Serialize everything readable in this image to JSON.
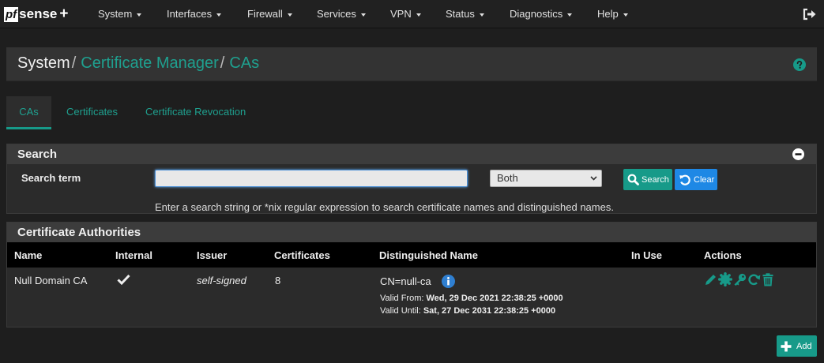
{
  "brand": {
    "logo_pf": "pf",
    "logo_sense": "sense",
    "logo_plus": "+"
  },
  "nav": {
    "items": [
      {
        "label": "System"
      },
      {
        "label": "Interfaces"
      },
      {
        "label": "Firewall"
      },
      {
        "label": "Services"
      },
      {
        "label": "VPN"
      },
      {
        "label": "Status"
      },
      {
        "label": "Diagnostics"
      },
      {
        "label": "Help"
      }
    ]
  },
  "breadcrumb": {
    "root": "System",
    "sep": "/",
    "section": "Certificate Manager",
    "page": "CAs"
  },
  "tabs": [
    {
      "label": "CAs",
      "active": true
    },
    {
      "label": "Certificates",
      "active": false
    },
    {
      "label": "Certificate Revocation",
      "active": false
    }
  ],
  "search_panel": {
    "title": "Search",
    "term_label": "Search term",
    "input_value": "",
    "select_value": "Both",
    "search_button": "Search",
    "clear_button": "Clear",
    "help": "Enter a search string or *nix regular expression to search certificate names and distinguished names."
  },
  "ca_panel": {
    "title": "Certificate Authorities",
    "columns": [
      "Name",
      "Internal",
      "Issuer",
      "Certificates",
      "Distinguished Name",
      "In Use",
      "Actions"
    ],
    "rows": [
      {
        "name": "Null Domain CA",
        "internal": true,
        "issuer": "self-signed",
        "certificates": "8",
        "dn": "CN=null-ca",
        "valid_from_label": "Valid From:",
        "valid_from": "Wed, 29 Dec 2021 22:38:25 +0000",
        "valid_until_label": "Valid Until:",
        "valid_until": "Sat, 27 Dec 2031 22:38:25 +0000",
        "in_use": ""
      }
    ]
  },
  "add_button": "Add",
  "colors": {
    "accent": "#179a89",
    "link": "#1fa08f",
    "clear": "#1e88e5",
    "info": "#2f7fd1"
  }
}
